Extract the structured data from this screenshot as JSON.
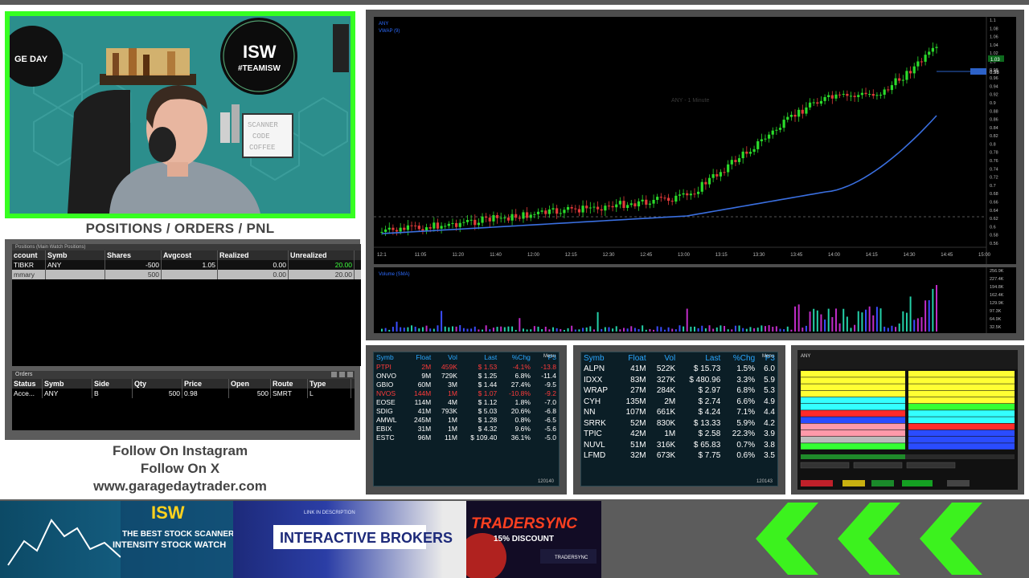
{
  "webcam": {
    "logo_left": "GE DAY",
    "logo_right_main": "ISW",
    "logo_right_tag": "#TEAMISW",
    "sign_lines": [
      "SCANNER",
      "CODE",
      "COFFEE"
    ]
  },
  "positions_title": "POSITIONS / ORDERS / PNL",
  "positions": {
    "titlebar": "Positions (Main Watch Positions)",
    "headers": [
      "ccount",
      "Symb",
      "Shares",
      "Avgcost",
      "Realized",
      "Unrealized"
    ],
    "rows": [
      [
        "TIBKR",
        "ANY",
        "-500",
        "1.05",
        "0.00",
        "20.00"
      ],
      [
        "mmary",
        "",
        "500",
        "",
        "0.00",
        "20.00"
      ]
    ]
  },
  "orders": {
    "title": "Orders",
    "headers": [
      "Status",
      "Symb",
      "Side",
      "Qty",
      "Price",
      "Open",
      "Route",
      "Type"
    ],
    "rows": [
      [
        "Acce...",
        "ANY",
        "B",
        "500",
        "0.98",
        "500",
        "SMRT",
        "L"
      ]
    ]
  },
  "follow": [
    "Follow On Instagram",
    "Follow On X",
    "www.garagedaytrader.com"
  ],
  "chart": {
    "title_lines": [
      "ANY",
      "VWAP (9)"
    ],
    "watermark": "ANY - 1 Minute",
    "time_labels": [
      "12:1",
      "11:05",
      "11:20",
      "11:40",
      "12:00",
      "12:15",
      "12:30",
      "12:45",
      "13:00",
      "13:15",
      "13:30",
      "13:45",
      "14:00",
      "14:15",
      "14:30",
      "14:45",
      "15:00"
    ],
    "price_labels": [
      "1.1",
      "1.08",
      "1.06",
      "1.04",
      "1.02",
      "1.0",
      "0.98",
      "0.96",
      "0.94",
      "0.92",
      "0.9",
      "0.88",
      "0.86",
      "0.84",
      "0.82",
      "0.8",
      "0.78",
      "0.76",
      "0.74",
      "0.72",
      "0.7",
      "0.68",
      "0.66",
      "0.64",
      "0.62",
      "0.6",
      "0.58",
      "0.56"
    ],
    "last_price": "1.03",
    "vwap_price": "0.98",
    "volume_label": "Volume (SMA)",
    "volume_axis": [
      "256.9K",
      "227.4K",
      "194.8K",
      "162.4K",
      "129.9K",
      "97.3K",
      "64.9K",
      "32.5K"
    ]
  },
  "scanA": {
    "menu": "Menu",
    "headers": [
      "Symb",
      "Float",
      "Vol",
      "Last",
      "%Chg",
      "P3"
    ],
    "rows": [
      {
        "c": [
          "PTPI",
          "2M",
          "459K",
          "$ 1.53",
          "-4.1%",
          "-13.8"
        ],
        "color": "#ff3b3b"
      },
      {
        "c": [
          "ONVO",
          "9M",
          "729K",
          "$ 1.25",
          "6.8%",
          "-11.4"
        ],
        "color": "#ffffff"
      },
      {
        "c": [
          "GBIO",
          "60M",
          "3M",
          "$ 1.44",
          "27.4%",
          "-9.5"
        ],
        "color": "#ffffff"
      },
      {
        "c": [
          "NVOS",
          "144M",
          "1M",
          "$ 1.07",
          "-10.8%",
          "-9.2"
        ],
        "color": "#ff3b3b"
      },
      {
        "c": [
          "EOSE",
          "114M",
          "4M",
          "$ 1.12",
          "1.8%",
          "-7.0"
        ],
        "color": "#ffffff"
      },
      {
        "c": [
          "SDIG",
          "41M",
          "793K",
          "$ 5.03",
          "20.6%",
          "-6.8"
        ],
        "color": "#ffffff"
      },
      {
        "c": [
          "AMWL",
          "245M",
          "1M",
          "$ 1.28",
          "0.8%",
          "-6.5"
        ],
        "color": "#ffffff"
      },
      {
        "c": [
          "EBIX",
          "31M",
          "1M",
          "$ 4.32",
          "9.6%",
          "-5.6"
        ],
        "color": "#ffffff"
      },
      {
        "c": [
          "ESTC",
          "96M",
          "11M",
          "$ 109.40",
          "36.1%",
          "-5.0"
        ],
        "color": "#ffffff"
      }
    ],
    "footer": "120140"
  },
  "scanB": {
    "menu": "Menu",
    "headers": [
      "Symb",
      "Float",
      "Vol",
      "Last",
      "%Chg",
      "P3"
    ],
    "rows": [
      [
        "ALPN",
        "41M",
        "522K",
        "$ 15.73",
        "1.5%",
        "6.0"
      ],
      [
        "IDXX",
        "83M",
        "327K",
        "$ 480.96",
        "3.3%",
        "5.9"
      ],
      [
        "WRAP",
        "27M",
        "284K",
        "$ 2.97",
        "6.8%",
        "5.3"
      ],
      [
        "CYH",
        "135M",
        "2M",
        "$ 2.74",
        "6.6%",
        "4.9"
      ],
      [
        "NN",
        "107M",
        "661K",
        "$ 4.24",
        "7.1%",
        "4.4"
      ],
      [
        "SRRK",
        "52M",
        "830K",
        "$ 13.33",
        "5.9%",
        "4.2"
      ],
      [
        "TPIC",
        "42M",
        "1M",
        "$ 2.58",
        "22.3%",
        "3.9"
      ],
      [
        "NUVL",
        "51M",
        "316K",
        "$ 65.83",
        "0.7%",
        "3.8"
      ],
      [
        "LFMD",
        "32M",
        "673K",
        "$ 7.75",
        "0.6%",
        "3.5"
      ]
    ],
    "footer": "120143"
  },
  "level2": {
    "symbol": "ANY",
    "bid_rows": [
      {
        "color": "#ffff33"
      },
      {
        "color": "#ffff33"
      },
      {
        "color": "#ffff33"
      },
      {
        "color": "#ffff33"
      },
      {
        "color": "#33ffff"
      },
      {
        "color": "#33ffff"
      },
      {
        "color": "#ff2a2a"
      },
      {
        "color": "#2a4cff"
      },
      {
        "color": "#ff99aa"
      },
      {
        "color": "#ff99aa"
      },
      {
        "color": "#bbbbbb"
      },
      {
        "color": "#33ff33"
      }
    ],
    "ask_rows": [
      {
        "color": "#ffff33"
      },
      {
        "color": "#ffff33"
      },
      {
        "color": "#ffff33"
      },
      {
        "color": "#ffff33"
      },
      {
        "color": "#ffff33"
      },
      {
        "color": "#33ff33"
      },
      {
        "color": "#33ffff"
      },
      {
        "color": "#33ffff"
      },
      {
        "color": "#ff2a2a"
      },
      {
        "color": "#2a4cff"
      },
      {
        "color": "#2a4cff"
      },
      {
        "color": "#2a4cff"
      }
    ]
  },
  "ads": {
    "isw_logo": "ISW",
    "isw_line1": "THE BEST STOCK SCANNER",
    "isw_line2": "INTENSITY STOCK WATCH",
    "ib_top": "LINK IN DESCRIPTION",
    "ib_main": "INTERACTIVE BROKERS",
    "ts_main": "TRADERSYNC",
    "ts_sub": "15% DISCOUNT",
    "ts_brand": "TRADERSYNC"
  },
  "colors": {
    "green_frame": "#36ff21",
    "panel_gray": "#4d4d4d",
    "arrow_green": "#3cf21e",
    "vwap_blue": "#3a6fe0"
  }
}
